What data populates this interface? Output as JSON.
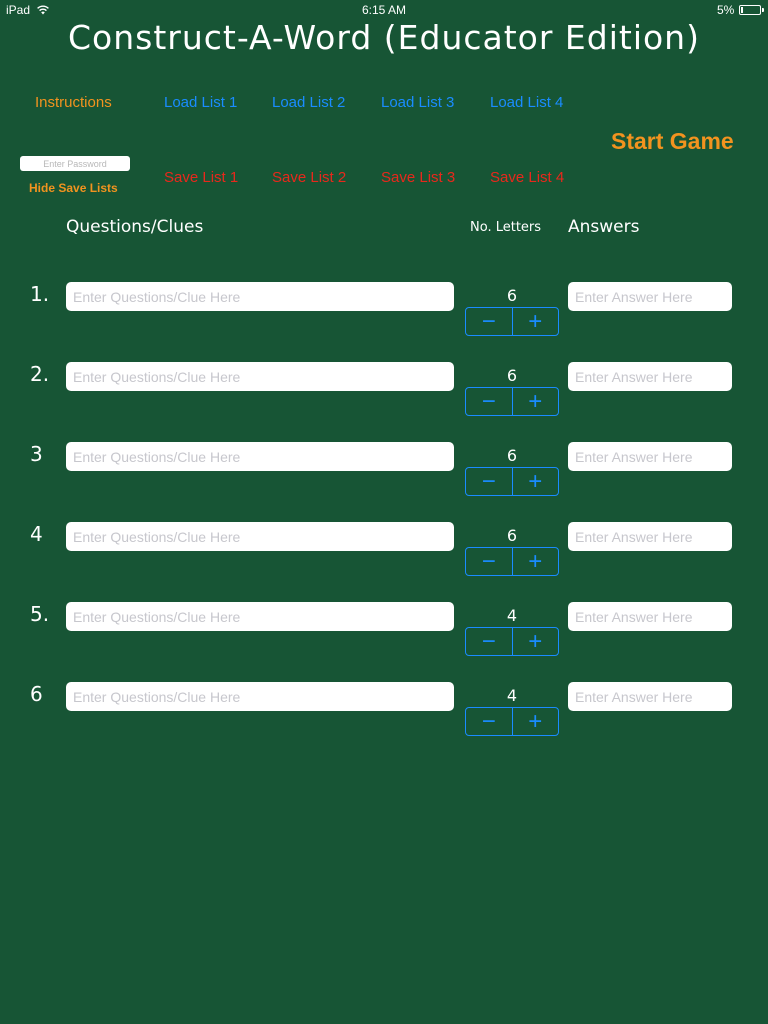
{
  "status_bar": {
    "device": "iPad",
    "time": "6:15 AM",
    "battery": "5%"
  },
  "title": "Construct-A-Word (Educator Edition)",
  "nav": {
    "instructions": "Instructions",
    "load_lists": [
      "Load List 1",
      "Load List 2",
      "Load List 3",
      "Load List 4"
    ],
    "save_lists": [
      "Save List 1",
      "Save List 2",
      "Save List 3",
      "Save List 4"
    ],
    "start_game": "Start Game",
    "hide_save_lists": "Hide Save Lists",
    "password_placeholder": "Enter Password"
  },
  "columns": {
    "questions": "Questions/Clues",
    "letters": "No. Letters",
    "answers": "Answers"
  },
  "rows": [
    {
      "number": "1.",
      "clue_placeholder": "Enter Questions/Clue Here",
      "letters": "6",
      "answer_placeholder": "Enter Answer Here"
    },
    {
      "number": "2.",
      "clue_placeholder": "Enter Questions/Clue Here",
      "letters": "6",
      "answer_placeholder": "Enter Answer Here"
    },
    {
      "number": "3",
      "clue_placeholder": "Enter Questions/Clue Here",
      "letters": "6",
      "answer_placeholder": "Enter Answer Here"
    },
    {
      "number": "4",
      "clue_placeholder": "Enter Questions/Clue Here",
      "letters": "6",
      "answer_placeholder": "Enter Answer Here"
    },
    {
      "number": "5.",
      "clue_placeholder": "Enter Questions/Clue Here",
      "letters": "4",
      "answer_placeholder": "Enter Answer Here"
    },
    {
      "number": "6",
      "clue_placeholder": "Enter Questions/Clue Here",
      "letters": "4",
      "answer_placeholder": "Enter Answer Here"
    }
  ],
  "stepper": {
    "minus": "−",
    "plus": "+"
  },
  "colors": {
    "background": "#175535",
    "accent_orange": "#f2931f",
    "link_blue": "#1a8cff",
    "save_red": "#e8281c"
  },
  "icons": {
    "wifi": "wifi-icon",
    "battery": "battery-icon"
  }
}
